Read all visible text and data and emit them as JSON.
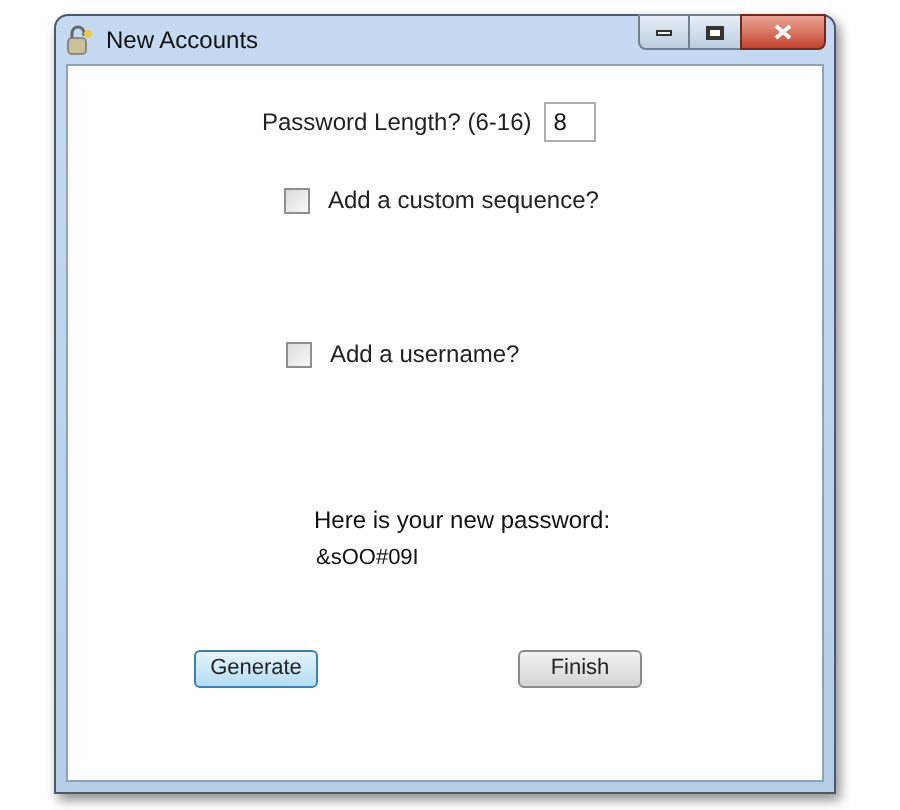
{
  "window": {
    "title": "New Accounts"
  },
  "length": {
    "label": "Password Length? (6-16)",
    "value": "8"
  },
  "options": [
    {
      "label": "Add a custom sequence?",
      "checked": false
    },
    {
      "label": "Add a username?",
      "checked": false
    }
  ],
  "result": {
    "heading": "Here is your new password:",
    "password": "&sOO#09I"
  },
  "buttons": [
    {
      "label": "Generate",
      "focused": true
    },
    {
      "label": "Finish",
      "focused": false
    }
  ]
}
